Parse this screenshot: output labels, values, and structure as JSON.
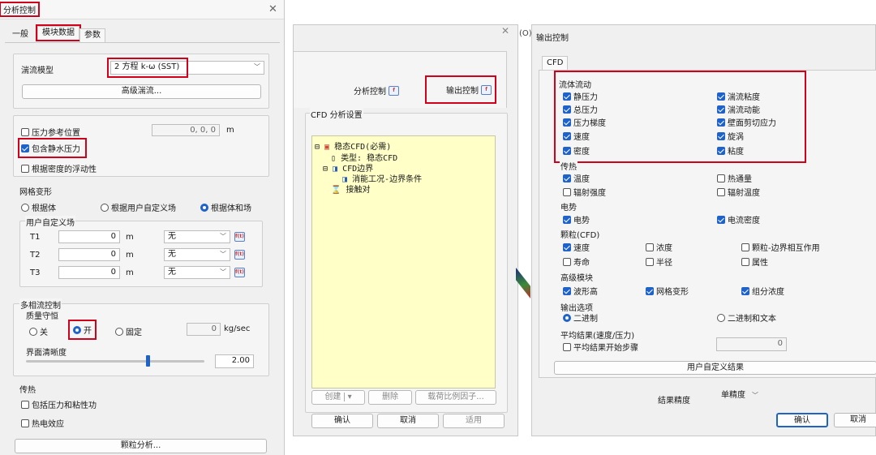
{
  "dlg1": {
    "title": "分析控制",
    "tabs": [
      "一般",
      "模块数据",
      "参数"
    ],
    "turbulence_label": "湍流模型",
    "turbulence_value": "2 方程 k-ω (SST)",
    "advanced_turbulence": "高级湍流...",
    "pressure_ref": "压力参考位置",
    "pressure_ref_value": "0, 0, 0",
    "unit_m": "m",
    "include_static": "包含静水压力",
    "buoyancy": "根据密度的浮动性",
    "mesh_deform": "网格变形",
    "radio_body": "根据体",
    "radio_user_field": "根据用户自定义场",
    "radio_body_and": "根据体和场",
    "user_field": "用户自定义场",
    "rows": [
      {
        "label": "T1",
        "value": "0",
        "unit": "m",
        "select": "无"
      },
      {
        "label": "T2",
        "value": "0",
        "unit": "m",
        "select": "无"
      },
      {
        "label": "T3",
        "value": "0",
        "unit": "m",
        "select": "无"
      }
    ],
    "multiphase": "多相流控制",
    "mass_conserve": "质量守恒",
    "off": "关",
    "on": "开",
    "fixed": "固定",
    "mass_value": "0",
    "mass_unit": "kg/sec",
    "interface": "界面清晰度",
    "interface_value": "2.00",
    "interface_level": 0.68,
    "heat": "传热",
    "pressure_work": "包括压力和粘性功",
    "thermoelectric": "热电效应",
    "particle": "颗粒分析..."
  },
  "dlg2": {
    "analysis_ctrl": "分析控制",
    "output_ctrl": "输出控制",
    "cfd_settings": "CFD 分析设置",
    "tree": {
      "root": "稳态CFD(必需)",
      "type": "类型: 稳态CFD",
      "boundary": "CFD边界",
      "boundary_child": "消能工况-边界条件",
      "contact": "接触对"
    },
    "create": "创建",
    "delete": "删除",
    "load_factor": "载荷比例因子...",
    "ok": "确认",
    "cancel": "取消",
    "apply": "适用",
    "tab_fragment": "(O)"
  },
  "dlg3": {
    "title": "输出控制",
    "tab": "CFD",
    "fluid_flow": "流体流动",
    "fluid_left": [
      "静压力",
      "总压力",
      "压力梯度",
      "速度",
      "密度"
    ],
    "fluid_right": [
      "湍流粘度",
      "湍流动能",
      "壁面剪切应力",
      "旋涡",
      "粘度"
    ],
    "heat": "传热",
    "heat_items": [
      [
        "温度",
        true
      ],
      [
        "热通量",
        false
      ],
      [
        "辐射强度",
        false
      ],
      [
        "辐射温度",
        false
      ]
    ],
    "elec": "电势",
    "elec_items": [
      [
        "电势",
        true
      ],
      [
        "电流密度",
        true
      ]
    ],
    "particle": "颗粒(CFD)",
    "particle_items": [
      [
        "速度",
        true
      ],
      [
        "浓度",
        false
      ],
      [
        "颗粒-边界相互作用",
        false
      ],
      [
        "寿命",
        false
      ],
      [
        "半径",
        false
      ],
      [
        "属性",
        false
      ]
    ],
    "adv": "高级模块",
    "adv_items": [
      [
        "波形高",
        true
      ],
      [
        "网格变形",
        true
      ],
      [
        "组分浓度",
        true
      ]
    ],
    "out_opt": "输出选项",
    "binary": "二进制",
    "binary_text": "二进制和文本",
    "avg": "平均结果(速度/压力)",
    "avg_start": "平均结果开始步骤",
    "avg_value": "0",
    "user_result": "用户自定义结果",
    "precision_label": "结果精度",
    "precision_value": "单精度",
    "ok": "确认",
    "cancel": "取消"
  }
}
